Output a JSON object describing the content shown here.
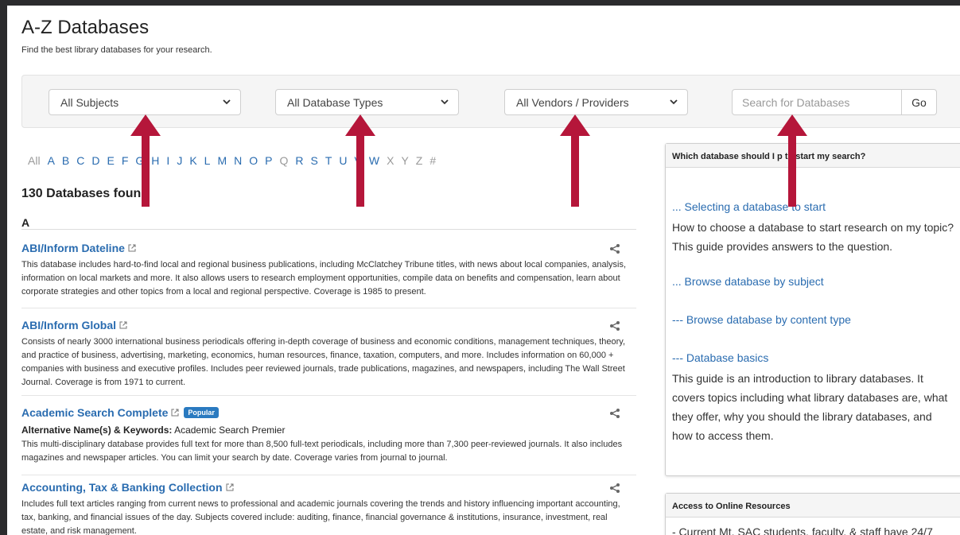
{
  "page": {
    "title": "A-Z Databases",
    "subtitle": "Find the best library databases for your research."
  },
  "filters": {
    "subjects": "All Subjects",
    "types": "All Database Types",
    "vendors": "All Vendors / Providers",
    "search_placeholder": "Search for Databases",
    "go_label": "Go"
  },
  "alphabet": [
    {
      "label": "All",
      "active": false
    },
    {
      "label": "A",
      "active": true
    },
    {
      "label": "B",
      "active": true
    },
    {
      "label": "C",
      "active": true
    },
    {
      "label": "D",
      "active": true
    },
    {
      "label": "E",
      "active": true
    },
    {
      "label": "F",
      "active": true
    },
    {
      "label": "G",
      "active": true
    },
    {
      "label": "H",
      "active": true
    },
    {
      "label": "I",
      "active": true
    },
    {
      "label": "J",
      "active": true
    },
    {
      "label": "K",
      "active": true
    },
    {
      "label": "L",
      "active": true
    },
    {
      "label": "M",
      "active": true
    },
    {
      "label": "N",
      "active": true
    },
    {
      "label": "O",
      "active": true
    },
    {
      "label": "P",
      "active": true
    },
    {
      "label": "Q",
      "active": false
    },
    {
      "label": "R",
      "active": true
    },
    {
      "label": "S",
      "active": true
    },
    {
      "label": "T",
      "active": true
    },
    {
      "label": "U",
      "active": true
    },
    {
      "label": "V",
      "active": true
    },
    {
      "label": "W",
      "active": true
    },
    {
      "label": "X",
      "active": false
    },
    {
      "label": "Y",
      "active": false
    },
    {
      "label": "Z",
      "active": false
    },
    {
      "label": "#",
      "active": false
    }
  ],
  "results": {
    "count_label": "130 Databases foun",
    "letter": "A",
    "databases": [
      {
        "title": "ABI/Inform Dateline",
        "description": "This database includes hard-to-find local and regional business publications, including McClatchey Tribune titles, with news about local companies, analysis, information on local markets and more. It also allows users to research employment opportunities, compile data on benefits and compensation, learn about corporate strategies and other topics from a local and regional perspective. Coverage is 1985 to present."
      },
      {
        "title": "ABI/Inform Global",
        "description": "Consists of nearly 3000 international business periodicals offering in-depth coverage of business and economic conditions, management techniques, theory, and practice of business, advertising, marketing, economics, human resources, finance, taxation, computers, and more. Includes information on 60,000 + companies with business and executive profiles. Includes peer reviewed journals, trade publications, magazines, and newspapers, including The Wall Street Journal. Coverage is from 1971 to current."
      },
      {
        "title": "Academic Search Complete",
        "badge": "Popular",
        "alt_label": "Alternative Name(s) & Keywords:",
        "alt_value": "Academic Search Premier",
        "description": "This multi-disciplinary database provides full text for more than 8,500 full-text periodicals, including more than 7,300 peer-reviewed journals. It also includes magazines and newspaper articles. You can limit your search by date. Coverage varies from journal to journal."
      },
      {
        "title": "Accounting, Tax & Banking Collection",
        "description": "Includes full text articles ranging from current news to professional and academic journals covering the trends and history influencing important accounting, tax, banking, and financial issues of the day. Subjects covered include: auditing, finance, financial governance & institutions, insurance, investment, real estate, and risk management."
      }
    ]
  },
  "sidebar": {
    "panel1": {
      "heading": "Which database should I p",
      "heading_end": "to start my search?",
      "link1": "... Selecting a database to start",
      "text1": "How to choose a database to start research on my topic? This guide provides answers to the question.",
      "link2": "... Browse database by subject",
      "link3": "--- Browse database by content type",
      "link4": "--- Database basics",
      "text2": "This guide is an introduction to library databases. It covers topics including what library databases are, what they offer, why you should the library databases, and how to access them."
    },
    "panel2": {
      "heading": "Access to Online Resources",
      "text": "- Current Mt. SAC students, faculty, & staff have 24/7"
    }
  },
  "colors": {
    "link": "#2a6cb0",
    "arrow": "#b5163a",
    "badge": "#2a7ac0",
    "frame": "#2b2b2d"
  }
}
